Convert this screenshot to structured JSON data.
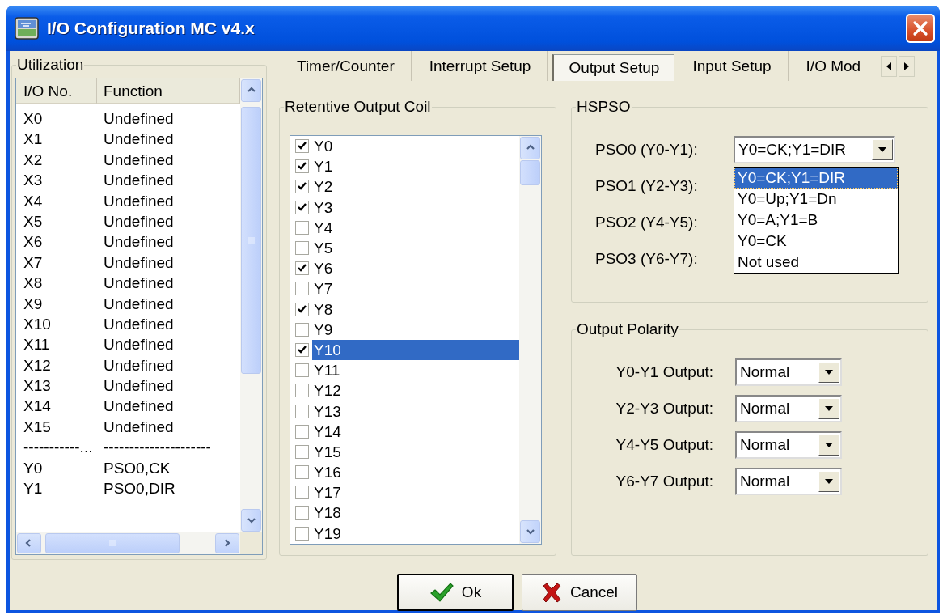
{
  "window": {
    "title": "I/O Configuration MC v4.x"
  },
  "utilization": {
    "title": "Utilization",
    "columns": [
      "I/O No.",
      "Function"
    ],
    "rows": [
      {
        "io": "X0",
        "function": "Undefined"
      },
      {
        "io": "X1",
        "function": "Undefined"
      },
      {
        "io": "X2",
        "function": "Undefined"
      },
      {
        "io": "X3",
        "function": "Undefined"
      },
      {
        "io": "X4",
        "function": "Undefined"
      },
      {
        "io": "X5",
        "function": "Undefined"
      },
      {
        "io": "X6",
        "function": "Undefined"
      },
      {
        "io": "X7",
        "function": "Undefined"
      },
      {
        "io": "X8",
        "function": "Undefined"
      },
      {
        "io": "X9",
        "function": "Undefined"
      },
      {
        "io": "X10",
        "function": "Undefined"
      },
      {
        "io": "X11",
        "function": "Undefined"
      },
      {
        "io": "X12",
        "function": "Undefined"
      },
      {
        "io": "X13",
        "function": "Undefined"
      },
      {
        "io": "X14",
        "function": "Undefined"
      },
      {
        "io": "X15",
        "function": "Undefined"
      },
      {
        "io": "-----------...",
        "function": "---------------------"
      },
      {
        "io": "Y0",
        "function": "PSO0,CK"
      },
      {
        "io": "Y1",
        "function": "PSO0,DIR"
      }
    ]
  },
  "tabs": [
    {
      "label": "Timer/Counter",
      "selected": false
    },
    {
      "label": "Interrupt Setup",
      "selected": false
    },
    {
      "label": "Output Setup",
      "selected": true
    },
    {
      "label": "Input Setup",
      "selected": false
    },
    {
      "label": "I/O Mod",
      "selected": false
    }
  ],
  "retentive_output_coil": {
    "title": "Retentive Output Coil",
    "items": [
      {
        "label": "Y0",
        "checked": true,
        "selected": false
      },
      {
        "label": "Y1",
        "checked": true,
        "selected": false
      },
      {
        "label": "Y2",
        "checked": true,
        "selected": false
      },
      {
        "label": "Y3",
        "checked": true,
        "selected": false
      },
      {
        "label": "Y4",
        "checked": false,
        "selected": false
      },
      {
        "label": "Y5",
        "checked": false,
        "selected": false
      },
      {
        "label": "Y6",
        "checked": true,
        "selected": false
      },
      {
        "label": "Y7",
        "checked": false,
        "selected": false
      },
      {
        "label": "Y8",
        "checked": true,
        "selected": false
      },
      {
        "label": "Y9",
        "checked": false,
        "selected": false
      },
      {
        "label": "Y10",
        "checked": true,
        "selected": true
      },
      {
        "label": "Y11",
        "checked": false,
        "selected": false
      },
      {
        "label": "Y12",
        "checked": false,
        "selected": false
      },
      {
        "label": "Y13",
        "checked": false,
        "selected": false
      },
      {
        "label": "Y14",
        "checked": false,
        "selected": false
      },
      {
        "label": "Y15",
        "checked": false,
        "selected": false
      },
      {
        "label": "Y16",
        "checked": false,
        "selected": false
      },
      {
        "label": "Y17",
        "checked": false,
        "selected": false
      },
      {
        "label": "Y18",
        "checked": false,
        "selected": false
      },
      {
        "label": "Y19",
        "checked": false,
        "selected": false
      }
    ]
  },
  "hspso": {
    "title": "HSPSO",
    "rows": [
      {
        "label": "PSO0 (Y0-Y1):",
        "value": "Y0=CK;Y1=DIR",
        "expanded": true,
        "options": [
          {
            "label": "Y0=CK;Y1=DIR",
            "selected": true
          },
          {
            "label": "Y0=Up;Y1=Dn",
            "selected": false
          },
          {
            "label": "Y0=A;Y1=B",
            "selected": false
          },
          {
            "label": "Y0=CK",
            "selected": false
          },
          {
            "label": "Not used",
            "selected": false
          }
        ]
      },
      {
        "label": "PSO1 (Y2-Y3):"
      },
      {
        "label": "PSO2 (Y4-Y5):"
      },
      {
        "label": "PSO3 (Y6-Y7):"
      }
    ]
  },
  "output_polarity": {
    "title": "Output Polarity",
    "rows": [
      {
        "label": "Y0-Y1 Output:",
        "value": "Normal"
      },
      {
        "label": "Y2-Y3 Output:",
        "value": "Normal"
      },
      {
        "label": "Y4-Y5 Output:",
        "value": "Normal"
      },
      {
        "label": "Y6-Y7 Output:",
        "value": "Normal"
      }
    ]
  },
  "buttons": [
    {
      "label": "Ok",
      "kind": "ok"
    },
    {
      "label": "Cancel",
      "kind": "cancel"
    }
  ]
}
